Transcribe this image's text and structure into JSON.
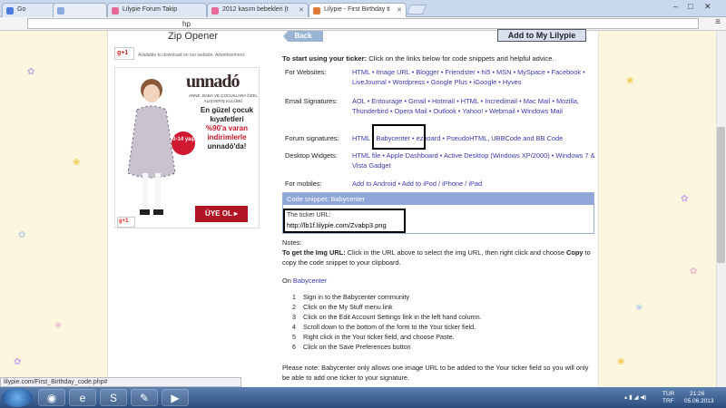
{
  "browser": {
    "tabs": [
      {
        "label": "Go",
        "active": false
      },
      {
        "label": "",
        "active": false
      },
      {
        "label": "Lilypie Forum Takip",
        "active": false
      },
      {
        "label": "2012 kasım bebekleri (t",
        "active": false
      },
      {
        "label": "Lilypie - First Birthday ti",
        "active": true
      }
    ],
    "address": "hp",
    "status_url": "lilypie.com/First_Birthday_code.php#"
  },
  "left": {
    "zip_title": "Zip Opener",
    "gplus_count": "+1",
    "ad_note": "Available to download on our website. Advertisement.",
    "ad": {
      "brand": "unnadó",
      "subtitle": "ANNE, BABA VE ÇOCUKLARA ÖZEL ALIŞVERİŞ KULÜBÜ",
      "badge": "0-14 yaş",
      "promo_line1": "En güzel çocuk kıyafetleri",
      "promo_red": "%90'a varan indirimlerle",
      "promo_line3": "unnadó'da!",
      "cta": "ÜYE OL",
      "gplus": "+1"
    }
  },
  "main": {
    "back_label": "Back",
    "add_label": "Add to My Lilypie",
    "intro_bold": "To start using your ticker:",
    "intro_rest": " Click on the links below for code snippets and helpful advice.",
    "rows": [
      {
        "label": "For Websites:",
        "links": "HTML • Image URL • Blogger • Friendster • hi5 • MSN • MySpace • Facebook • LiveJournal • Wordpress • Google Plus • iGoogle • Hyves"
      },
      {
        "label": "Email Signatures:",
        "links": "AOL • Entourage • Gmail • Hotmail • HTML • Incredimail • Mac Mail • Mozilla, Thunderbird • Opera Mail • Outlook • Yahoo! • Webmail • Windows Mail"
      },
      {
        "label": "Forum signatures:",
        "links": "HTML • Babycenter • ezboard • PseudoHTML, UBBCode and BB Code"
      },
      {
        "label": "Desktop Widgets:",
        "links": "HTML file • Apple Dashboard • Active Desktop (Windows XP/2000) • Windows 7 & Vista Gadget"
      },
      {
        "label": "For mobiles:",
        "links": "Add to Android • Add to iPod / iPhone / iPad"
      }
    ],
    "snippet": {
      "header": "Code snippet: Babycenter",
      "label": "The ticker URL:",
      "value": "http://lb1f.lilypie.com/Zvabp3.png"
    },
    "notes_title": "Notes:",
    "notes_bold": "To get the Img URL:",
    "notes_text": " Click in the URL above to select the img URL, then right click and choose ",
    "notes_copy": "Copy",
    "notes_text2": " to copy the code snippet to your clipboard.",
    "on_label": "On ",
    "on_site": "Babycenter",
    "steps": [
      "Sign in to the Babycenter community",
      "Click on the My Stuff menu link",
      "Click on the Edit Account Settings link in the left hand column.",
      "Scroll down to the bottom of the form to the Your ticker field.",
      "Right click in the Your ticker field, and choose Paste.",
      "Click on the Save Preferences button"
    ],
    "please_note": "Please note: Babycenter only allows one image URL to be added to the Your ticker field so you will only be able to add one ticker to your signature."
  },
  "taskbar": {
    "lang": "TUR",
    "lang2": "TRF",
    "time": "21:26",
    "date": "05.06.2013"
  },
  "colors": {
    "page_bg": "#fbf6dd",
    "link": "#3a3ab0",
    "snippet_header": "#8fa6d8",
    "ad_red": "#b01425"
  }
}
